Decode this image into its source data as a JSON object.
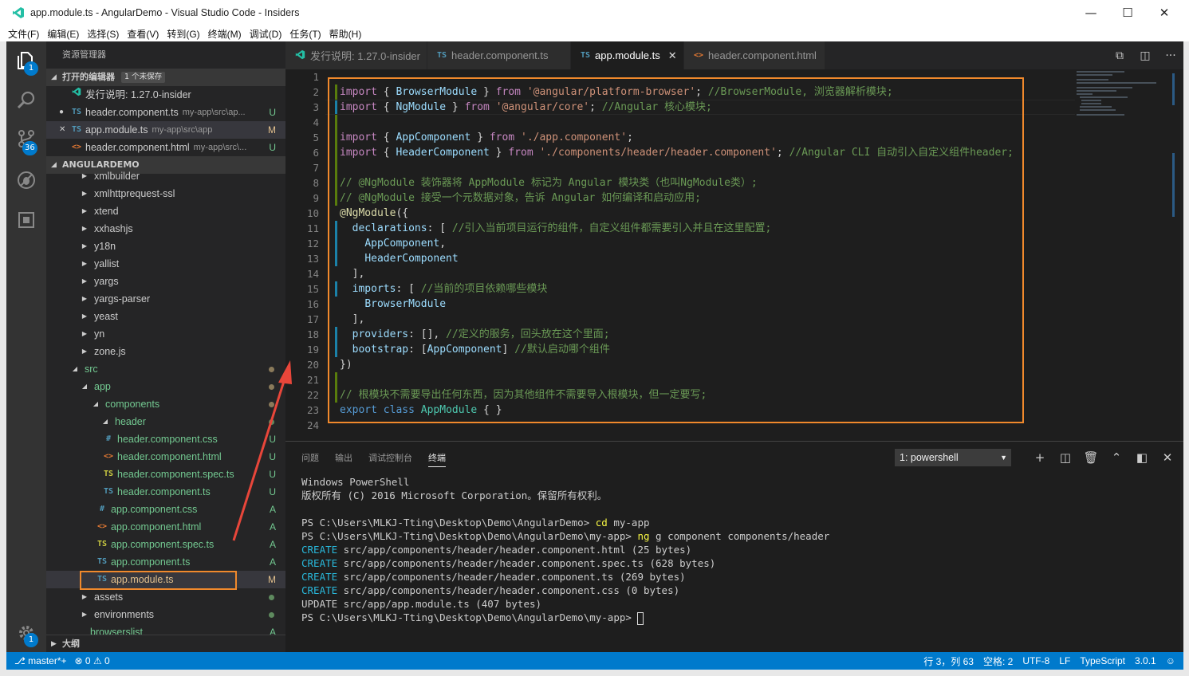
{
  "window": {
    "title": "app.module.ts - AngularDemo - Visual Studio Code - Insiders",
    "controls": [
      "minimize-icon",
      "maximize-icon",
      "close-icon"
    ]
  },
  "menu": [
    "文件(F)",
    "编辑(E)",
    "选择(S)",
    "查看(V)",
    "转到(G)",
    "终端(M)",
    "调试(D)",
    "任务(T)",
    "帮助(H)"
  ],
  "activity": {
    "explorer_badge": "1",
    "scm_badge": "36",
    "settings_badge": "1"
  },
  "sidebar": {
    "title": "资源管理器",
    "open_editors": {
      "label": "打开的编辑器",
      "unsaved": "1 个未保存",
      "items": [
        {
          "icon": "vscode",
          "name": "发行说明: 1.27.0-insider",
          "path": "",
          "status": ""
        },
        {
          "icon": "TS",
          "name": "header.component.ts",
          "path": "my-app\\src\\ap...",
          "status": "U"
        },
        {
          "icon": "TS",
          "name": "app.module.ts",
          "path": "my-app\\src\\app",
          "status": "M"
        },
        {
          "icon": "<>",
          "name": "header.component.html",
          "path": "my-app\\src\\...",
          "status": "U"
        }
      ]
    },
    "project": {
      "label": "ANGULARDEMO",
      "tree": [
        {
          "name": "xmlbuilder",
          "indent": 1,
          "kind": "folder"
        },
        {
          "name": "xmlhttprequest-ssl",
          "indent": 1,
          "kind": "folder"
        },
        {
          "name": "xtend",
          "indent": 1,
          "kind": "folder"
        },
        {
          "name": "xxhashjs",
          "indent": 1,
          "kind": "folder"
        },
        {
          "name": "y18n",
          "indent": 1,
          "kind": "folder"
        },
        {
          "name": "yallist",
          "indent": 1,
          "kind": "folder"
        },
        {
          "name": "yargs",
          "indent": 1,
          "kind": "folder"
        },
        {
          "name": "yargs-parser",
          "indent": 1,
          "kind": "folder"
        },
        {
          "name": "yeast",
          "indent": 1,
          "kind": "folder"
        },
        {
          "name": "yn",
          "indent": 1,
          "kind": "folder"
        },
        {
          "name": "zone.js",
          "indent": 1,
          "kind": "folder"
        },
        {
          "name": "src",
          "indent": 0,
          "kind": "open"
        },
        {
          "name": "app",
          "indent": 1,
          "kind": "open"
        },
        {
          "name": "components",
          "indent": 2,
          "kind": "open"
        },
        {
          "name": "header",
          "indent": 3,
          "kind": "open"
        },
        {
          "name": "header.component.css",
          "indent": 4,
          "kind": "css",
          "status": "U"
        },
        {
          "name": "header.component.html",
          "indent": 4,
          "kind": "html",
          "status": "U"
        },
        {
          "name": "header.component.spec.ts",
          "indent": 4,
          "kind": "spec",
          "status": "U"
        },
        {
          "name": "header.component.ts",
          "indent": 4,
          "kind": "ts",
          "status": "U"
        },
        {
          "name": "app.component.css",
          "indent": 3,
          "kind": "css",
          "status": "A"
        },
        {
          "name": "app.component.html",
          "indent": 3,
          "kind": "html",
          "status": "A"
        },
        {
          "name": "app.component.spec.ts",
          "indent": 3,
          "kind": "spec",
          "status": "A"
        },
        {
          "name": "app.component.ts",
          "indent": 3,
          "kind": "ts",
          "status": "A"
        },
        {
          "name": "app.module.ts",
          "indent": 3,
          "kind": "ts",
          "status": "M"
        },
        {
          "name": "assets",
          "indent": 1,
          "kind": "folder"
        },
        {
          "name": "environments",
          "indent": 1,
          "kind": "folder"
        },
        {
          "name": "browserslist",
          "indent": 1,
          "kind": "file",
          "status": "A"
        }
      ],
      "outline_label": "大纲"
    }
  },
  "tabs": [
    {
      "icon": "vscode",
      "label": "发行说明: 1.27.0-insider"
    },
    {
      "icon": "TS",
      "label": "header.component.ts"
    },
    {
      "icon": "TS",
      "label": "app.module.ts"
    },
    {
      "icon": "<>",
      "label": "header.component.html"
    }
  ],
  "editor": {
    "line_numbers": [
      "1",
      "2",
      "3",
      "4",
      "5",
      "6",
      "7",
      "8",
      "9",
      "10",
      "11",
      "12",
      "13",
      "14",
      "15",
      "16",
      "17",
      "18",
      "19",
      "20",
      "21",
      "22",
      "23",
      "24"
    ]
  },
  "panel": {
    "tabs": [
      "问题",
      "输出",
      "调试控制台",
      "终端"
    ],
    "active_tab": "终端",
    "terminal_select": "1: powershell",
    "lines": [
      {
        "a": "Windows PowerShell",
        "b": "",
        "c": ""
      },
      {
        "a": "版权所有 (C) 2016 Microsoft Corporation。保留所有权利。",
        "b": "",
        "c": ""
      },
      {
        "a": "",
        "b": "",
        "c": ""
      },
      {
        "a": "PS C:\\Users\\MLKJ-Tting\\Desktop\\Demo\\AngularDemo> ",
        "b": "cd",
        "c": " my-app"
      },
      {
        "a": "PS C:\\Users\\MLKJ-Tting\\Desktop\\Demo\\AngularDemo\\my-app> ",
        "b": "ng",
        "c": " g component components/header"
      },
      {
        "a": "",
        "b": "CREATE",
        "c": " src/app/components/header/header.component.html (25 bytes)"
      },
      {
        "a": "",
        "b": "CREATE",
        "c": " src/app/components/header/header.component.spec.ts (628 bytes)"
      },
      {
        "a": "",
        "b": "CREATE",
        "c": " src/app/components/header/header.component.ts (269 bytes)"
      },
      {
        "a": "",
        "b": "CREATE",
        "c": " src/app/components/header/header.component.css (0 bytes)"
      },
      {
        "a": "UPDATE src/app/app.module.ts (407 bytes)",
        "b": "",
        "c": ""
      },
      {
        "a": "PS C:\\Users\\MLKJ-Tting\\Desktop\\Demo\\AngularDemo\\my-app> ",
        "b": "",
        "c": ""
      }
    ]
  },
  "status": {
    "branch": "master*+",
    "errors": "0",
    "warnings": "0",
    "position": "行 3，列 63",
    "spaces": "空格: 2",
    "encoding": "UTF-8",
    "eol": "LF",
    "language": "TypeScript",
    "version": "3.0.1"
  },
  "colors": {
    "accent": "#007acc",
    "highlight": "#f0892c",
    "arrow": "#e8463a"
  }
}
